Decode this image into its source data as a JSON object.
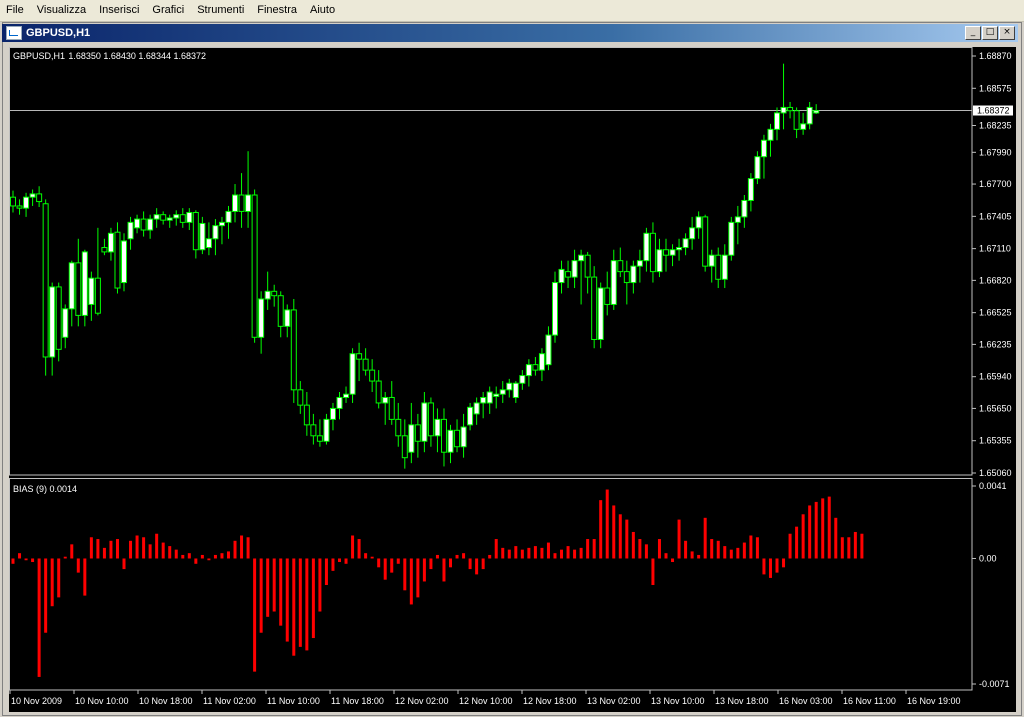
{
  "menu": [
    "File",
    "Visualizza",
    "Inserisci",
    "Grafici",
    "Strumenti",
    "Finestra",
    "Aiuto"
  ],
  "window": {
    "title": "GBPUSD,H1",
    "btn_min": "_",
    "btn_max": "□",
    "btn_close": "×"
  },
  "colors": {
    "bg": "#000000",
    "candle": "#00ff00",
    "bull_body": "#ffffff",
    "bear_body": "#000000",
    "hist": "#ff0000",
    "axis": "#c0c0c0",
    "text": "#ffffff"
  },
  "chart_data": [
    {
      "type": "candlestick",
      "title": "GBPUSD,H1",
      "info_values": "1.68350 1.68430 1.68344 1.68372",
      "ylim": [
        1.6506,
        1.6887
      ],
      "price_ticks": [
        "1.68870",
        "1.68575",
        "1.68235",
        "1.67990",
        "1.67700",
        "1.67405",
        "1.67110",
        "1.66820",
        "1.66525",
        "1.66235",
        "1.65940",
        "1.65650",
        "1.65355",
        "1.65060"
      ],
      "current_price": "1.68372",
      "current_price_value": 1.68372,
      "ohlc": [
        [
          1.6758,
          1.6764,
          1.6744,
          1.675
        ],
        [
          1.675,
          1.6756,
          1.6742,
          1.6748
        ],
        [
          1.6748,
          1.6762,
          1.674,
          1.6758
        ],
        [
          1.6758,
          1.6765,
          1.675,
          1.6761
        ],
        [
          1.6761,
          1.6768,
          1.6749,
          1.6754
        ],
        [
          1.6752,
          1.6756,
          1.6595,
          1.6612
        ],
        [
          1.6612,
          1.668,
          1.6595,
          1.6676
        ],
        [
          1.6676,
          1.668,
          1.6608,
          1.6619
        ],
        [
          1.663,
          1.666,
          1.662,
          1.6656
        ],
        [
          1.6656,
          1.67,
          1.664,
          1.6698
        ],
        [
          1.6698,
          1.672,
          1.664,
          1.665
        ],
        [
          1.665,
          1.671,
          1.664,
          1.6708
        ],
        [
          1.666,
          1.669,
          1.6645,
          1.6684
        ],
        [
          1.6684,
          1.673,
          1.665,
          1.6652
        ],
        [
          1.6712,
          1.672,
          1.6705,
          1.6708
        ],
        [
          1.6708,
          1.673,
          1.67,
          1.6725
        ],
        [
          1.6726,
          1.6735,
          1.667,
          1.6675
        ],
        [
          1.668,
          1.6725,
          1.6672,
          1.6718
        ],
        [
          1.672,
          1.674,
          1.671,
          1.6735
        ],
        [
          1.673,
          1.6742,
          1.6725,
          1.6738
        ],
        [
          1.6738,
          1.6745,
          1.6722,
          1.6728
        ],
        [
          1.6728,
          1.6742,
          1.672,
          1.6738
        ],
        [
          1.6738,
          1.6748,
          1.673,
          1.6742
        ],
        [
          1.6742,
          1.6745,
          1.6733,
          1.6737
        ],
        [
          1.6737,
          1.6742,
          1.673,
          1.6739
        ],
        [
          1.6739,
          1.6746,
          1.6732,
          1.6742
        ],
        [
          1.6742,
          1.6748,
          1.673,
          1.6735
        ],
        [
          1.6735,
          1.6748,
          1.6728,
          1.6744
        ],
        [
          1.6744,
          1.6746,
          1.6702,
          1.671
        ],
        [
          1.671,
          1.674,
          1.6706,
          1.6734
        ],
        [
          1.6712,
          1.6735,
          1.6705,
          1.672
        ],
        [
          1.672,
          1.6738,
          1.6705,
          1.6732
        ],
        [
          1.6732,
          1.674,
          1.6715,
          1.6735
        ],
        [
          1.6735,
          1.675,
          1.672,
          1.6745
        ],
        [
          1.6745,
          1.677,
          1.6735,
          1.676
        ],
        [
          1.676,
          1.678,
          1.673,
          1.6745
        ],
        [
          1.6745,
          1.68,
          1.673,
          1.676
        ],
        [
          1.676,
          1.6765,
          1.6625,
          1.663
        ],
        [
          1.663,
          1.6672,
          1.6615,
          1.6665
        ],
        [
          1.6665,
          1.669,
          1.6655,
          1.6672
        ],
        [
          1.6672,
          1.6678,
          1.6658,
          1.6668
        ],
        [
          1.6668,
          1.6672,
          1.663,
          1.664
        ],
        [
          1.664,
          1.666,
          1.663,
          1.6655
        ],
        [
          1.6655,
          1.6665,
          1.657,
          1.6582
        ],
        [
          1.6582,
          1.659,
          1.656,
          1.6568
        ],
        [
          1.6568,
          1.658,
          1.654,
          1.655
        ],
        [
          1.655,
          1.656,
          1.6532,
          1.654
        ],
        [
          1.654,
          1.6555,
          1.653,
          1.6535
        ],
        [
          1.6535,
          1.656,
          1.6532,
          1.6555
        ],
        [
          1.6555,
          1.657,
          1.6545,
          1.6565
        ],
        [
          1.6565,
          1.658,
          1.6555,
          1.6575
        ],
        [
          1.6575,
          1.6585,
          1.657,
          1.6578
        ],
        [
          1.6578,
          1.662,
          1.657,
          1.6615
        ],
        [
          1.6615,
          1.6625,
          1.659,
          1.661
        ],
        [
          1.661,
          1.662,
          1.6595,
          1.66
        ],
        [
          1.66,
          1.661,
          1.658,
          1.659
        ],
        [
          1.659,
          1.66,
          1.6565,
          1.657
        ],
        [
          1.657,
          1.658,
          1.655,
          1.6575
        ],
        [
          1.6575,
          1.659,
          1.655,
          1.6555
        ],
        [
          1.6555,
          1.657,
          1.653,
          1.654
        ],
        [
          1.654,
          1.6555,
          1.651,
          1.652
        ],
        [
          1.6525,
          1.657,
          1.6515,
          1.655
        ],
        [
          1.655,
          1.656,
          1.652,
          1.6535
        ],
        [
          1.6535,
          1.658,
          1.6525,
          1.657
        ],
        [
          1.657,
          1.6575,
          1.653,
          1.654
        ],
        [
          1.654,
          1.6565,
          1.6525,
          1.6555
        ],
        [
          1.6555,
          1.6565,
          1.6512,
          1.6525
        ],
        [
          1.6525,
          1.655,
          1.6515,
          1.6545
        ],
        [
          1.6545,
          1.6555,
          1.6525,
          1.653
        ],
        [
          1.653,
          1.656,
          1.652,
          1.6548
        ],
        [
          1.655,
          1.657,
          1.6545,
          1.6566
        ],
        [
          1.656,
          1.6575,
          1.655,
          1.657
        ],
        [
          1.657,
          1.658,
          1.6556,
          1.6575
        ],
        [
          1.657,
          1.6585,
          1.656,
          1.658
        ],
        [
          1.6576,
          1.6585,
          1.6565,
          1.6578
        ],
        [
          1.6578,
          1.659,
          1.657,
          1.6582
        ],
        [
          1.6582,
          1.6592,
          1.6575,
          1.6588
        ],
        [
          1.6575,
          1.659,
          1.657,
          1.6588
        ],
        [
          1.6588,
          1.66,
          1.6582,
          1.6595
        ],
        [
          1.6595,
          1.661,
          1.6585,
          1.6605
        ],
        [
          1.6605,
          1.6612,
          1.6595,
          1.66
        ],
        [
          1.66,
          1.662,
          1.659,
          1.6615
        ],
        [
          1.6605,
          1.664,
          1.66,
          1.6632
        ],
        [
          1.6632,
          1.669,
          1.6625,
          1.668
        ],
        [
          1.668,
          1.67,
          1.667,
          1.6692
        ],
        [
          1.669,
          1.67,
          1.6675,
          1.6685
        ],
        [
          1.6685,
          1.671,
          1.6675,
          1.67
        ],
        [
          1.67,
          1.671,
          1.666,
          1.6705
        ],
        [
          1.6705,
          1.6708,
          1.667,
          1.6685
        ],
        [
          1.6685,
          1.6695,
          1.662,
          1.6628
        ],
        [
          1.6628,
          1.668,
          1.662,
          1.6675
        ],
        [
          1.6675,
          1.669,
          1.665,
          1.666
        ],
        [
          1.666,
          1.671,
          1.6655,
          1.67
        ],
        [
          1.67,
          1.6712,
          1.6685,
          1.669
        ],
        [
          1.669,
          1.67,
          1.666,
          1.668
        ],
        [
          1.668,
          1.67,
          1.667,
          1.6695
        ],
        [
          1.6695,
          1.671,
          1.668,
          1.67
        ],
        [
          1.67,
          1.673,
          1.669,
          1.6725
        ],
        [
          1.6725,
          1.6735,
          1.668,
          1.669
        ],
        [
          1.669,
          1.672,
          1.6685,
          1.671
        ],
        [
          1.671,
          1.672,
          1.669,
          1.6705
        ],
        [
          1.6705,
          1.6715,
          1.6695,
          1.671
        ],
        [
          1.671,
          1.672,
          1.67,
          1.6712
        ],
        [
          1.6712,
          1.6725,
          1.6705,
          1.672
        ],
        [
          1.672,
          1.674,
          1.671,
          1.673
        ],
        [
          1.673,
          1.6745,
          1.672,
          1.674
        ],
        [
          1.674,
          1.6742,
          1.669,
          1.6695
        ],
        [
          1.6695,
          1.671,
          1.668,
          1.6705
        ],
        [
          1.6705,
          1.6712,
          1.6675,
          1.6683
        ],
        [
          1.6683,
          1.6715,
          1.6675,
          1.6705
        ],
        [
          1.6705,
          1.674,
          1.67,
          1.6735
        ],
        [
          1.6735,
          1.675,
          1.6715,
          1.674
        ],
        [
          1.674,
          1.676,
          1.673,
          1.6755
        ],
        [
          1.6755,
          1.678,
          1.6745,
          1.6775
        ],
        [
          1.6775,
          1.68,
          1.677,
          1.6795
        ],
        [
          1.6795,
          1.6815,
          1.6775,
          1.681
        ],
        [
          1.681,
          1.6825,
          1.6795,
          1.682
        ],
        [
          1.682,
          1.684,
          1.681,
          1.6835
        ],
        [
          1.6835,
          1.688,
          1.682,
          1.684
        ],
        [
          1.684,
          1.6845,
          1.683,
          1.6837
        ],
        [
          1.6837,
          1.684,
          1.6812,
          1.682
        ],
        [
          1.682,
          1.6835,
          1.6815,
          1.6825
        ],
        [
          1.6825,
          1.6845,
          1.682,
          1.684
        ],
        [
          1.6835,
          1.6843,
          1.6834,
          1.6837
        ]
      ],
      "x_labels": [
        "10 Nov 2009",
        "10 Nov 10:00",
        "10 Nov 18:00",
        "11 Nov 02:00",
        "11 Nov 10:00",
        "11 Nov 18:00",
        "12 Nov 02:00",
        "12 Nov 10:00",
        "12 Nov 18:00",
        "13 Nov 02:00",
        "13 Nov 10:00",
        "13 Nov 18:00",
        "16 Nov 03:00",
        "16 Nov 11:00",
        "16 Nov 19:00"
      ]
    },
    {
      "type": "bar",
      "title": "BIAS (9) 0.0014",
      "ylim": [
        -0.0071,
        0.0041
      ],
      "y_ticks": [
        "0.0041",
        "0.00",
        "-0.0071"
      ],
      "values": [
        -0.0003,
        0.0003,
        -0.0001,
        -0.0002,
        -0.0067,
        -0.0042,
        -0.0027,
        -0.0022,
        0.0001,
        0.0008,
        -0.0008,
        -0.0021,
        0.0012,
        0.0011,
        0.0006,
        0.001,
        0.0011,
        -0.0006,
        0.001,
        0.0013,
        0.0012,
        0.0008,
        0.0014,
        0.0009,
        0.0007,
        0.0005,
        0.0002,
        0.0003,
        -0.0003,
        0.0002,
        -0.0001,
        0.0002,
        0.0003,
        0.0004,
        0.001,
        0.0013,
        0.0012,
        -0.0064,
        -0.0042,
        -0.0033,
        -0.003,
        -0.0038,
        -0.0047,
        -0.0055,
        -0.005,
        -0.0052,
        -0.0045,
        -0.003,
        -0.0015,
        -0.0007,
        -0.0002,
        -0.0003,
        0.0013,
        0.0011,
        0.0003,
        0.0001,
        -0.0005,
        -0.0012,
        -0.0008,
        -0.0003,
        -0.0018,
        -0.0026,
        -0.0022,
        -0.0013,
        -0.0006,
        0.0002,
        -0.0013,
        -0.0005,
        0.0002,
        0.0003,
        -0.0006,
        -0.0009,
        -0.0006,
        0.0002,
        0.0011,
        0.0006,
        0.0005,
        0.0007,
        0.0005,
        0.0006,
        0.0007,
        0.0006,
        0.0009,
        0.0003,
        0.0005,
        0.0007,
        0.0005,
        0.0006,
        0.0011,
        0.0011,
        0.0033,
        0.0039,
        0.003,
        0.0025,
        0.0022,
        0.0015,
        0.0011,
        0.0008,
        -0.0015,
        0.0011,
        0.0003,
        -0.0002,
        0.0022,
        0.001,
        0.0004,
        0.0002,
        0.0023,
        0.0011,
        0.001,
        0.0007,
        0.0005,
        0.0006,
        0.0009,
        0.0013,
        0.0012,
        -0.0009,
        -0.0011,
        -0.0008,
        -0.0005,
        0.0014,
        0.0018,
        0.0025,
        0.003,
        0.0032,
        0.0034,
        0.0035,
        0.0023,
        0.0012,
        0.0012,
        0.0015,
        0.0014
      ]
    }
  ]
}
